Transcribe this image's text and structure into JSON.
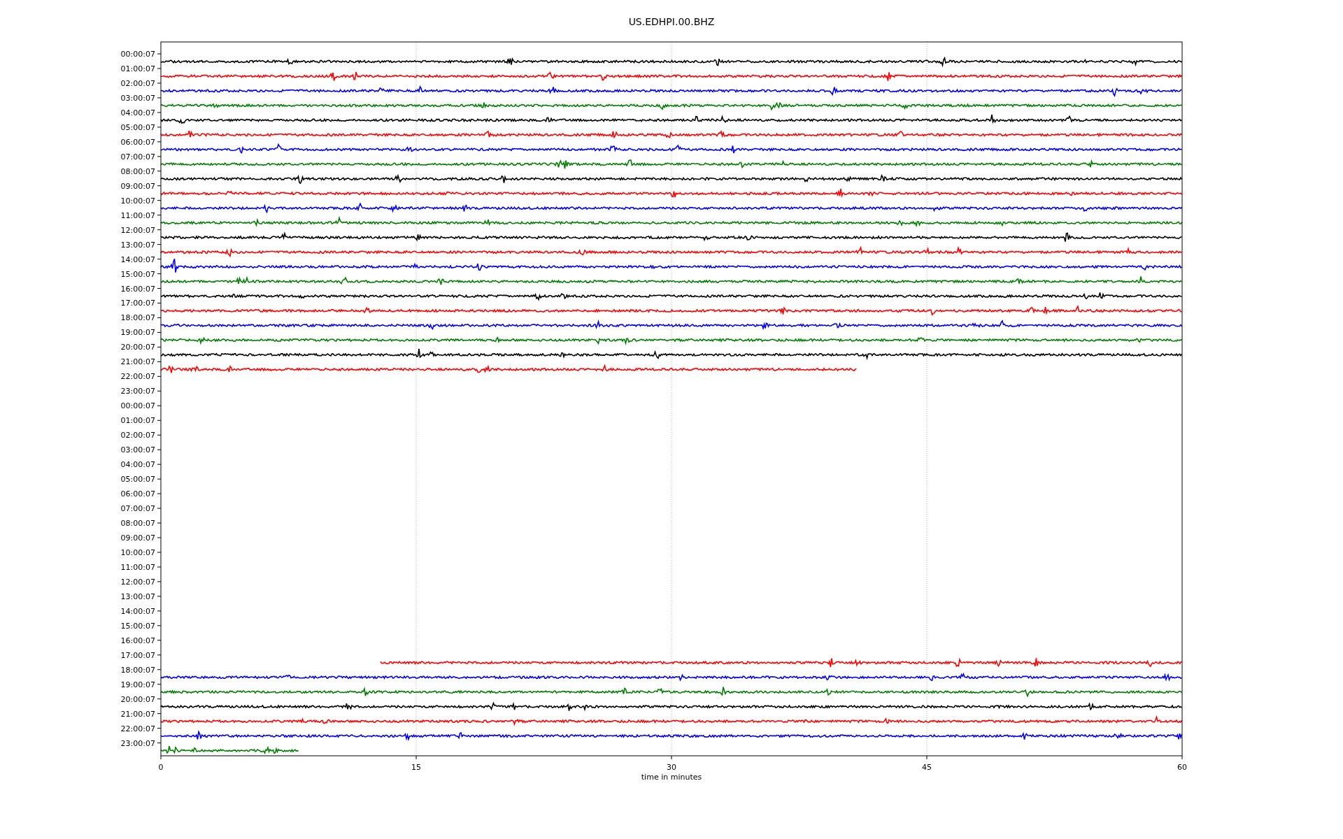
{
  "title": "US.EDHPI.00.BHZ",
  "xlabel": "time in minutes",
  "xticks": [
    "0",
    "15",
    "30",
    "45",
    "60"
  ],
  "rows": [
    {
      "label": "00:00:07",
      "trace": {
        "color": "#000000",
        "kind": "full"
      }
    },
    {
      "label": "01:00:07",
      "trace": {
        "color": "#ff0000",
        "kind": "full"
      }
    },
    {
      "label": "02:00:07",
      "trace": {
        "color": "#0000ff",
        "kind": "full"
      }
    },
    {
      "label": "03:00:07",
      "trace": {
        "color": "#008000",
        "kind": "full"
      }
    },
    {
      "label": "04:00:07",
      "trace": {
        "color": "#000000",
        "kind": "full"
      }
    },
    {
      "label": "05:00:07",
      "trace": {
        "color": "#ff0000",
        "kind": "full"
      }
    },
    {
      "label": "06:00:07",
      "trace": {
        "color": "#0000ff",
        "kind": "full"
      }
    },
    {
      "label": "07:00:07",
      "trace": {
        "color": "#008000",
        "kind": "full"
      }
    },
    {
      "label": "08:00:07",
      "trace": {
        "color": "#000000",
        "kind": "full"
      }
    },
    {
      "label": "09:00:07",
      "trace": {
        "color": "#ff0000",
        "kind": "full"
      }
    },
    {
      "label": "10:00:07",
      "trace": {
        "color": "#0000ff",
        "kind": "full"
      }
    },
    {
      "label": "11:00:07",
      "trace": {
        "color": "#008000",
        "kind": "full"
      }
    },
    {
      "label": "12:00:07",
      "trace": {
        "color": "#000000",
        "kind": "full"
      }
    },
    {
      "label": "13:00:07",
      "trace": {
        "color": "#ff0000",
        "kind": "full"
      }
    },
    {
      "label": "14:00:07",
      "trace": {
        "color": "#0000ff",
        "kind": "full"
      }
    },
    {
      "label": "15:00:07",
      "trace": {
        "color": "#008000",
        "kind": "full"
      }
    },
    {
      "label": "16:00:07",
      "trace": {
        "color": "#000000",
        "kind": "full"
      }
    },
    {
      "label": "17:00:07",
      "trace": {
        "color": "#ff0000",
        "kind": "full"
      }
    },
    {
      "label": "18:00:07",
      "trace": {
        "color": "#0000ff",
        "kind": "full"
      }
    },
    {
      "label": "19:00:07",
      "trace": {
        "color": "#008000",
        "kind": "full"
      }
    },
    {
      "label": "20:00:07",
      "trace": {
        "color": "#000000",
        "kind": "full"
      }
    },
    {
      "label": "21:00:07",
      "trace": {
        "color": "#ff0000",
        "kind": "ends_early"
      }
    },
    {
      "label": "22:00:07"
    },
    {
      "label": "23:00:07"
    },
    {
      "label": "00:00:07"
    },
    {
      "label": "01:00:07"
    },
    {
      "label": "02:00:07"
    },
    {
      "label": "03:00:07"
    },
    {
      "label": "04:00:07"
    },
    {
      "label": "05:00:07"
    },
    {
      "label": "06:00:07"
    },
    {
      "label": "07:00:07"
    },
    {
      "label": "08:00:07"
    },
    {
      "label": "09:00:07"
    },
    {
      "label": "10:00:07"
    },
    {
      "label": "11:00:07"
    },
    {
      "label": "12:00:07"
    },
    {
      "label": "13:00:07"
    },
    {
      "label": "14:00:07"
    },
    {
      "label": "15:00:07"
    },
    {
      "label": "16:00:07"
    },
    {
      "label": "17:00:07",
      "trace": {
        "color": "#ff0000",
        "kind": "starts_late"
      }
    },
    {
      "label": "18:00:07",
      "trace": {
        "color": "#0000ff",
        "kind": "full"
      }
    },
    {
      "label": "19:00:07",
      "trace": {
        "color": "#008000",
        "kind": "full"
      }
    },
    {
      "label": "20:00:07",
      "trace": {
        "color": "#000000",
        "kind": "full"
      }
    },
    {
      "label": "21:00:07",
      "trace": {
        "color": "#ff0000",
        "kind": "full"
      }
    },
    {
      "label": "22:00:07",
      "trace": {
        "color": "#0000ff",
        "kind": "full"
      }
    },
    {
      "label": "23:00:07",
      "trace": {
        "color": "#008000",
        "kind": "short"
      }
    }
  ]
}
